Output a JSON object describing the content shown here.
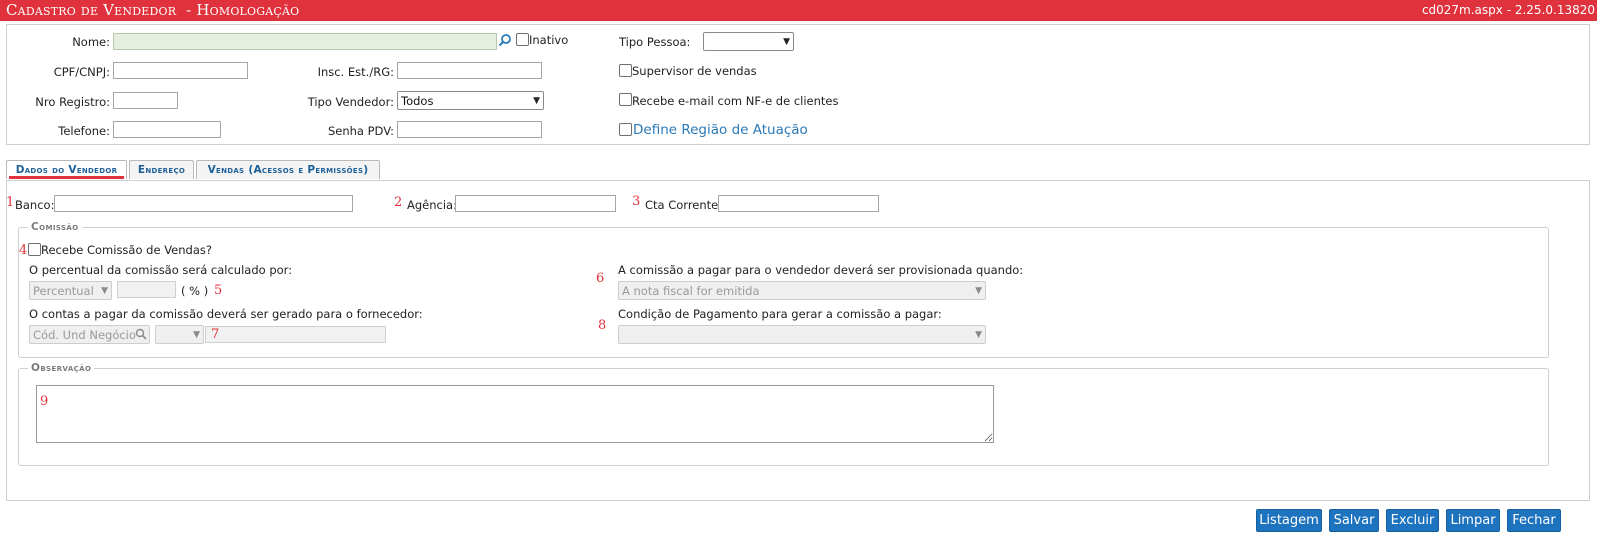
{
  "titlebar": {
    "title": "Cadastro de Vendedor  - Homologação",
    "version": "cd027m.aspx - 2.25.0.13820"
  },
  "header": {
    "nome_label": "Nome:",
    "inativo_label": "Inativo",
    "tipo_pessoa_label": "Tipo Pessoa:",
    "tipo_pessoa_value": "",
    "cpf_label": "CPF/CNPJ:",
    "insc_label": "Insc. Est./RG:",
    "supervisor_label": "Supervisor de vendas",
    "nro_registro_label": "Nro Registro:",
    "tipo_vendedor_label": "Tipo Vendedor:",
    "tipo_vendedor_value": "Todos",
    "recebe_email_label": "Recebe e-mail com NF-e de clientes",
    "telefone_label": "Telefone:",
    "senha_label": "Senha PDV:",
    "define_regiao_label": "Define Região de Atuação"
  },
  "tabs": [
    {
      "label": "Dados do Vendedor",
      "active": true
    },
    {
      "label": "Endereço",
      "active": false
    },
    {
      "label": "Vendas (Acessos e Permissões)",
      "active": false
    }
  ],
  "dados": {
    "banco_label": "Banco:",
    "agencia_label": "Agência:",
    "cta_label": "Cta Corrente:",
    "markers": [
      "1",
      "2",
      "3",
      "4",
      "5",
      "6",
      "7",
      "8",
      "9"
    ]
  },
  "comissao": {
    "legend": "Comissão",
    "recebe_label": "Recebe Comissão de Vendas?",
    "percentual_text": "O percentual da comissão será calculado por:",
    "percentual_select": "Percentual",
    "pct_suffix": "( % )",
    "provisionada_text": "A comissão a pagar para o vendedor deverá ser provisionada quando:",
    "provisionada_select": "A nota fiscal for emitida",
    "contas_text": "O contas a pagar da comissão deverá ser gerado para o fornecedor:",
    "und_negocio_placeholder": "Cód. Und Negócio",
    "condicao_text": "Condição de Pagamento para gerar a comissão a pagar:"
  },
  "observacao": {
    "legend": "Observação"
  },
  "buttons": {
    "listagem": "Listagem",
    "salvar": "Salvar",
    "excluir": "Excluir",
    "limpar": "Limpar",
    "fechar": "Fechar"
  },
  "colors": {
    "titlebar": "#e0323c",
    "button": "#1d73bd",
    "marker": "#e0323c",
    "link": "#2a7ab8"
  },
  "icons": [
    "search-icon",
    "chevron-down-icon"
  ]
}
